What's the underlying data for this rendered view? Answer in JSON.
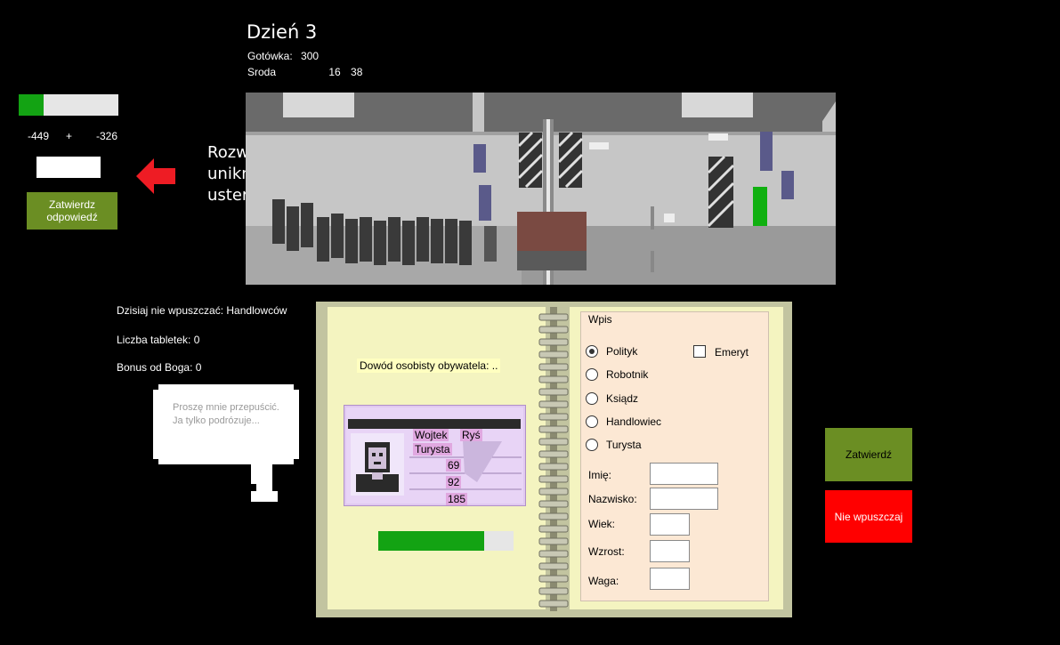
{
  "header": {
    "day": "Dzień 3",
    "cash_label": "Gotówka:",
    "cash_value": "300",
    "weekday": "Sroda",
    "hour": "16",
    "minute": "38"
  },
  "puzzle": {
    "timer_fraction": 0.25,
    "operand_a": "-449",
    "operator": "+",
    "operand_b": "-326",
    "answer_value": "",
    "submit_label": "Zatwierdz odpowiedź",
    "hint": "Rozwiąż zagadkę aby uniknąć kary i naprawić usterkę"
  },
  "rules": {
    "banned": "Dzisiaj nie wpuszczać: Handlowców",
    "pills": "Liczba tabletek: 0",
    "god_bonus": "Bonus od Boga:   0"
  },
  "speech": "Proszę mnie przepuścić. Ja tylko podrózuje...",
  "document": {
    "title": "Dowód osobisty obywatela: ..",
    "first_name": "Wojtek",
    "last_name": "Ryś",
    "profession": "Turysta",
    "age": "69",
    "weight": "92",
    "height": "185",
    "check_progress": 0.78
  },
  "form": {
    "title": "Wpis",
    "professions": [
      {
        "label": "Polityk",
        "selected": true
      },
      {
        "label": "Robotnik",
        "selected": false
      },
      {
        "label": "Ksiądz",
        "selected": false
      },
      {
        "label": "Handlowiec",
        "selected": false
      },
      {
        "label": "Turysta",
        "selected": false
      }
    ],
    "retired_label": "Emeryt",
    "retired_checked": false,
    "first_name_label": "Imię:",
    "last_name_label": "Nazwisko:",
    "age_label": "Wiek:",
    "height_label": "Wzrost:",
    "weight_label": "Waga:"
  },
  "actions": {
    "approve": "Zatwierdź",
    "deny": "Nie wpuszczaj"
  },
  "colors": {
    "progress": "#13a313",
    "approve": "#6b8e23",
    "deny": "#ff0000",
    "arrow": "#ee1c24"
  },
  "icons": [
    "arrow-left-icon",
    "passport-photo-icon",
    "radio-icon",
    "checkbox-icon"
  ]
}
